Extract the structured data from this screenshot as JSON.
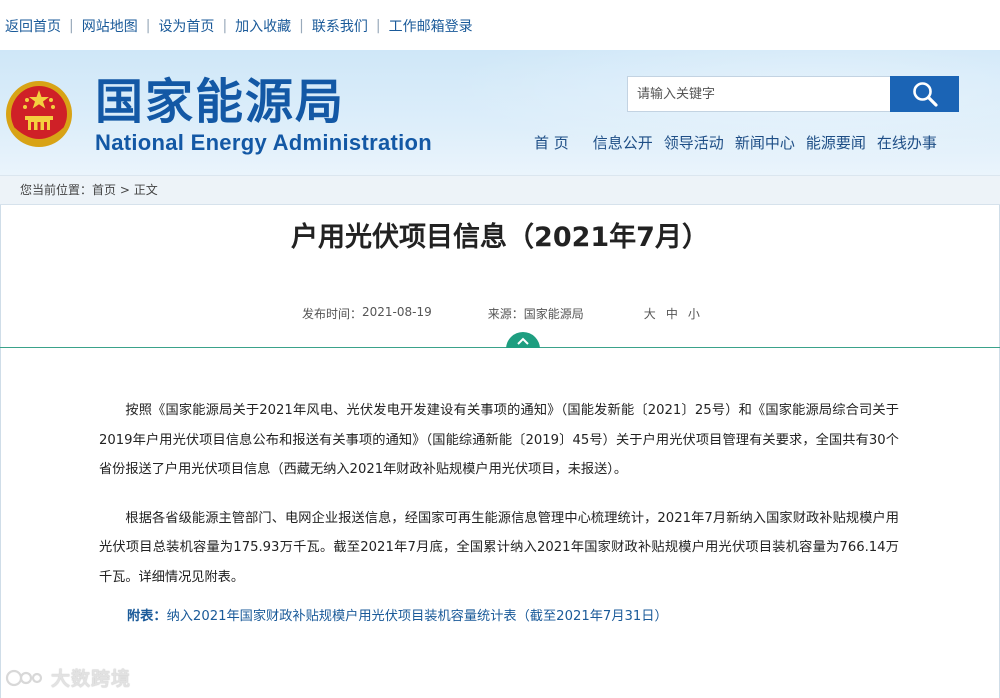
{
  "top_nav": [
    "返回首页",
    "网站地图",
    "设为首页",
    "加入收藏",
    "联系我们",
    "工作邮箱登录"
  ],
  "site": {
    "name_cn": "国家能源局",
    "name_en": "National Energy Administration"
  },
  "search": {
    "placeholder": "请输入关键字",
    "icon": "search-icon"
  },
  "main_nav": [
    "首 页",
    "信息公开",
    "领导活动",
    "新闻中心",
    "能源要闻",
    "在线办事"
  ],
  "breadcrumb": {
    "prefix": "您当前位置：",
    "home": "首页",
    "sep": " > ",
    "current": "正文"
  },
  "article": {
    "title": "户用光伏项目信息（2021年7月）",
    "publish_label": "发布时间：",
    "publish_date": "2021-08-19",
    "source_label": "来源：",
    "source": "国家能源局",
    "font_sizes": [
      "大",
      "中",
      "小"
    ],
    "paragraphs": [
      "按照《国家能源局关于2021年风电、光伏发电开发建设有关事项的通知》（国能发新能〔2021〕25号）和《国家能源局综合司关于2019年户用光伏项目信息公布和报送有关事项的通知》（国能综通新能〔2019〕45号）关于户用光伏项目管理有关要求，全国共有30个省份报送了户用光伏项目信息（西藏无纳入2021年财政补贴规模户用光伏项目，未报送）。",
      "根据各省级能源主管部门、电网企业报送信息，经国家可再生能源信息管理中心梳理统计，2021年7月新纳入国家财政补贴规模户用光伏项目总装机容量为175.93万千瓦。截至2021年7月底，全国累计纳入2021年国家财政补贴规模户用光伏项目装机容量为766.14万千瓦。详细情况见附表。"
    ],
    "attachment_label": "附表：",
    "attachment_link": "纳入2021年国家财政补贴规模户用光伏项目装机容量统计表（截至2021年7月31日）"
  },
  "watermark": "大数跨境",
  "colors": {
    "brand": "#1358a5",
    "accent_green": "#1e9e80",
    "search_button": "#1b64b5"
  }
}
